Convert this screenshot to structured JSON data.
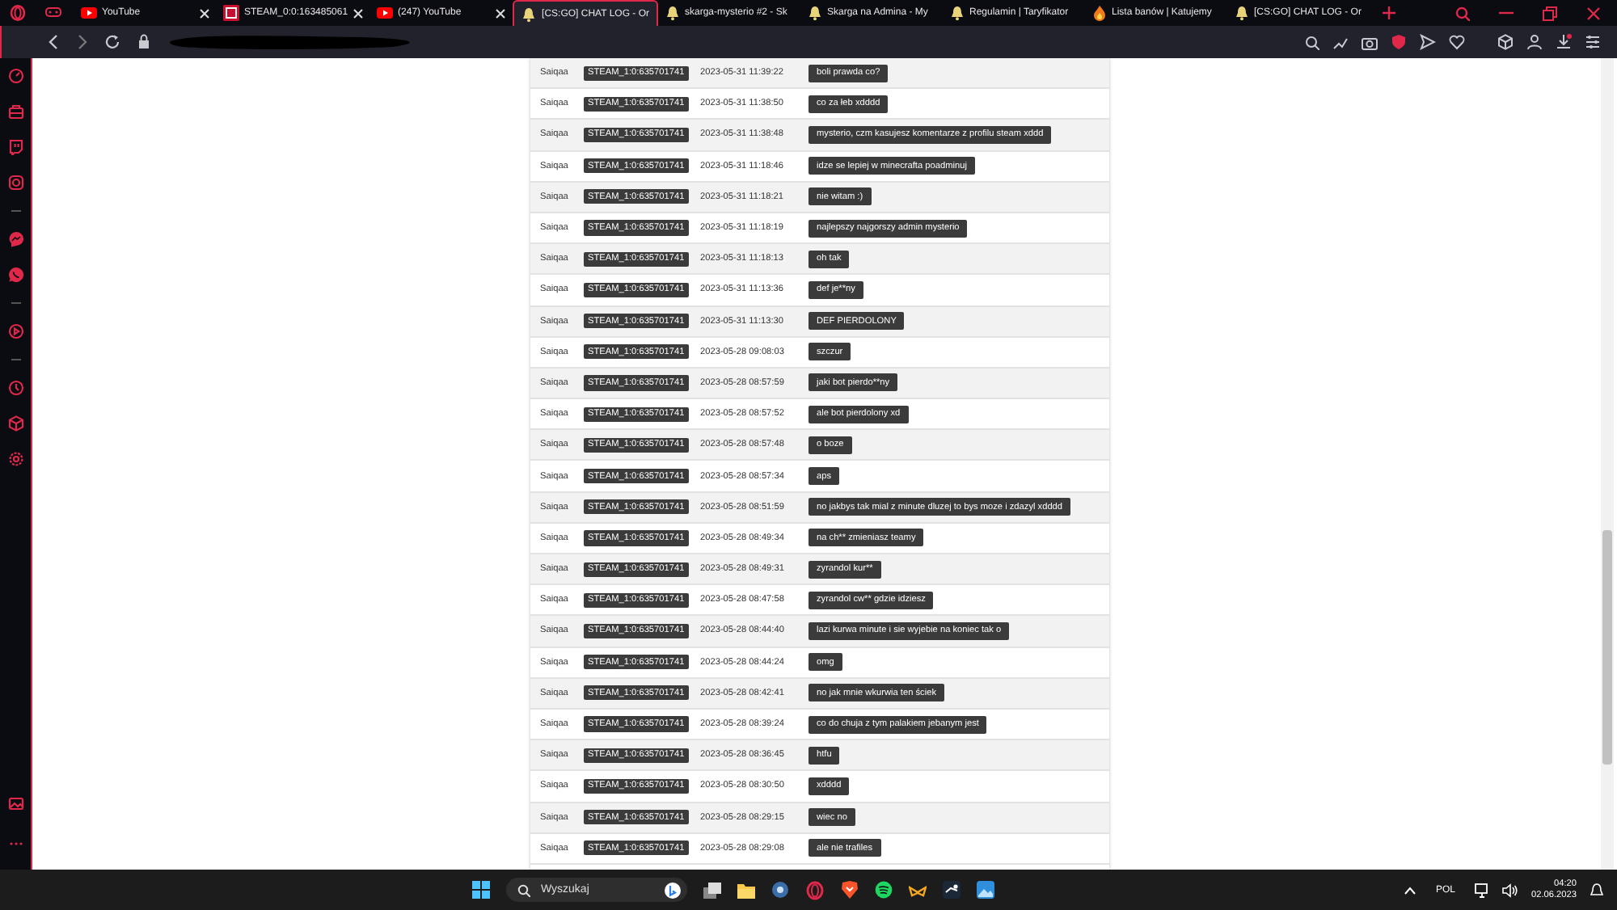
{
  "tabs": [
    {
      "kind": "pinned",
      "selected": false,
      "close": false
    },
    {
      "kind": "youtube",
      "label": "YouTube",
      "selected": false,
      "close": true
    },
    {
      "kind": "steam",
      "label": "STEAM_0:0:163485061",
      "selected": false,
      "close": true
    },
    {
      "kind": "youtube",
      "label": "(247) YouTube",
      "selected": false,
      "close": true
    },
    {
      "kind": "site",
      "label": "[CS:GO] CHAT LOG - Or",
      "selected": true,
      "close": false
    },
    {
      "kind": "site",
      "label": "skarga-mysterio #2 - Sk",
      "selected": false,
      "close": false
    },
    {
      "kind": "site",
      "label": "Skarga na Admina - My",
      "selected": false,
      "close": false
    },
    {
      "kind": "site",
      "label": "Regulamin | Taryfikator",
      "selected": false,
      "close": false
    },
    {
      "kind": "flame",
      "label": "Lista banów | Katujemy",
      "selected": false,
      "close": false
    },
    {
      "kind": "site",
      "label": "[CS:GO] CHAT LOG - Or",
      "selected": false,
      "close": false
    }
  ],
  "chat_log": [
    {
      "player": "Saiqaa",
      "steam_id": "STEAM_1:0:635701741",
      "time": "2023-05-31 11:39:22",
      "message": "boli prawda co?"
    },
    {
      "player": "Saiqaa",
      "steam_id": "STEAM_1:0:635701741",
      "time": "2023-05-31 11:38:50",
      "message": "co za łeb xdddd"
    },
    {
      "player": "Saiqaa",
      "steam_id": "STEAM_1:0:635701741",
      "time": "2023-05-31 11:38:48",
      "message": "mysterio, czm kasujesz komentarze z profilu steam xddd"
    },
    {
      "player": "Saiqaa",
      "steam_id": "STEAM_1:0:635701741",
      "time": "2023-05-31 11:18:46",
      "message": "idze se lepiej w minecrafta poadminuj"
    },
    {
      "player": "Saiqaa",
      "steam_id": "STEAM_1:0:635701741",
      "time": "2023-05-31 11:18:21",
      "message": "nie witam :)"
    },
    {
      "player": "Saiqaa",
      "steam_id": "STEAM_1:0:635701741",
      "time": "2023-05-31 11:18:19",
      "message": "najlepszy najgorszy admin mysterio"
    },
    {
      "player": "Saiqaa",
      "steam_id": "STEAM_1:0:635701741",
      "time": "2023-05-31 11:18:13",
      "message": "oh tak"
    },
    {
      "player": "Saiqaa",
      "steam_id": "STEAM_1:0:635701741",
      "time": "2023-05-31 11:13:36",
      "message": "def je**ny"
    },
    {
      "player": "Saiqaa",
      "steam_id": "STEAM_1:0:635701741",
      "time": "2023-05-31 11:13:30",
      "message": "DEF PIERDOLONY"
    },
    {
      "player": "Saiqaa",
      "steam_id": "STEAM_1:0:635701741",
      "time": "2023-05-28 09:08:03",
      "message": "szczur"
    },
    {
      "player": "Saiqaa",
      "steam_id": "STEAM_1:0:635701741",
      "time": "2023-05-28 08:57:59",
      "message": "jaki bot pierdo**ny"
    },
    {
      "player": "Saiqaa",
      "steam_id": "STEAM_1:0:635701741",
      "time": "2023-05-28 08:57:52",
      "message": "ale bot pierdolony xd"
    },
    {
      "player": "Saiqaa",
      "steam_id": "STEAM_1:0:635701741",
      "time": "2023-05-28 08:57:48",
      "message": "o boze"
    },
    {
      "player": "Saiqaa",
      "steam_id": "STEAM_1:0:635701741",
      "time": "2023-05-28 08:57:34",
      "message": "aps"
    },
    {
      "player": "Saiqaa",
      "steam_id": "STEAM_1:0:635701741",
      "time": "2023-05-28 08:51:59",
      "message": "no jakbys tak mial z minute dluzej to bys moze i zdazyl xdddd"
    },
    {
      "player": "Saiqaa",
      "steam_id": "STEAM_1:0:635701741",
      "time": "2023-05-28 08:49:34",
      "message": "na ch** zmieniasz teamy"
    },
    {
      "player": "Saiqaa",
      "steam_id": "STEAM_1:0:635701741",
      "time": "2023-05-28 08:49:31",
      "message": "zyrandol kur**"
    },
    {
      "player": "Saiqaa",
      "steam_id": "STEAM_1:0:635701741",
      "time": "2023-05-28 08:47:58",
      "message": "zyrandol cw** gdzie idziesz"
    },
    {
      "player": "Saiqaa",
      "steam_id": "STEAM_1:0:635701741",
      "time": "2023-05-28 08:44:40",
      "message": "lazi kurwa minute i sie wyjebie na koniec tak o"
    },
    {
      "player": "Saiqaa",
      "steam_id": "STEAM_1:0:635701741",
      "time": "2023-05-28 08:44:24",
      "message": "omg"
    },
    {
      "player": "Saiqaa",
      "steam_id": "STEAM_1:0:635701741",
      "time": "2023-05-28 08:42:41",
      "message": "no jak mnie wkurwia ten ściek"
    },
    {
      "player": "Saiqaa",
      "steam_id": "STEAM_1:0:635701741",
      "time": "2023-05-28 08:39:24",
      "message": "co do chuja z tym palakiem jebanym jest"
    },
    {
      "player": "Saiqaa",
      "steam_id": "STEAM_1:0:635701741",
      "time": "2023-05-28 08:36:45",
      "message": "htfu"
    },
    {
      "player": "Saiqaa",
      "steam_id": "STEAM_1:0:635701741",
      "time": "2023-05-28 08:30:50",
      "message": "xdddd"
    },
    {
      "player": "Saiqaa",
      "steam_id": "STEAM_1:0:635701741",
      "time": "2023-05-28 08:29:15",
      "message": "wiec no"
    },
    {
      "player": "Saiqaa",
      "steam_id": "STEAM_1:0:635701741",
      "time": "2023-05-28 08:29:08",
      "message": "ale nie trafiles"
    }
  ],
  "taskbar": {
    "search_placeholder": "Wyszukaj",
    "language": "POL",
    "time": "04:20",
    "date": "02.06.2023"
  }
}
